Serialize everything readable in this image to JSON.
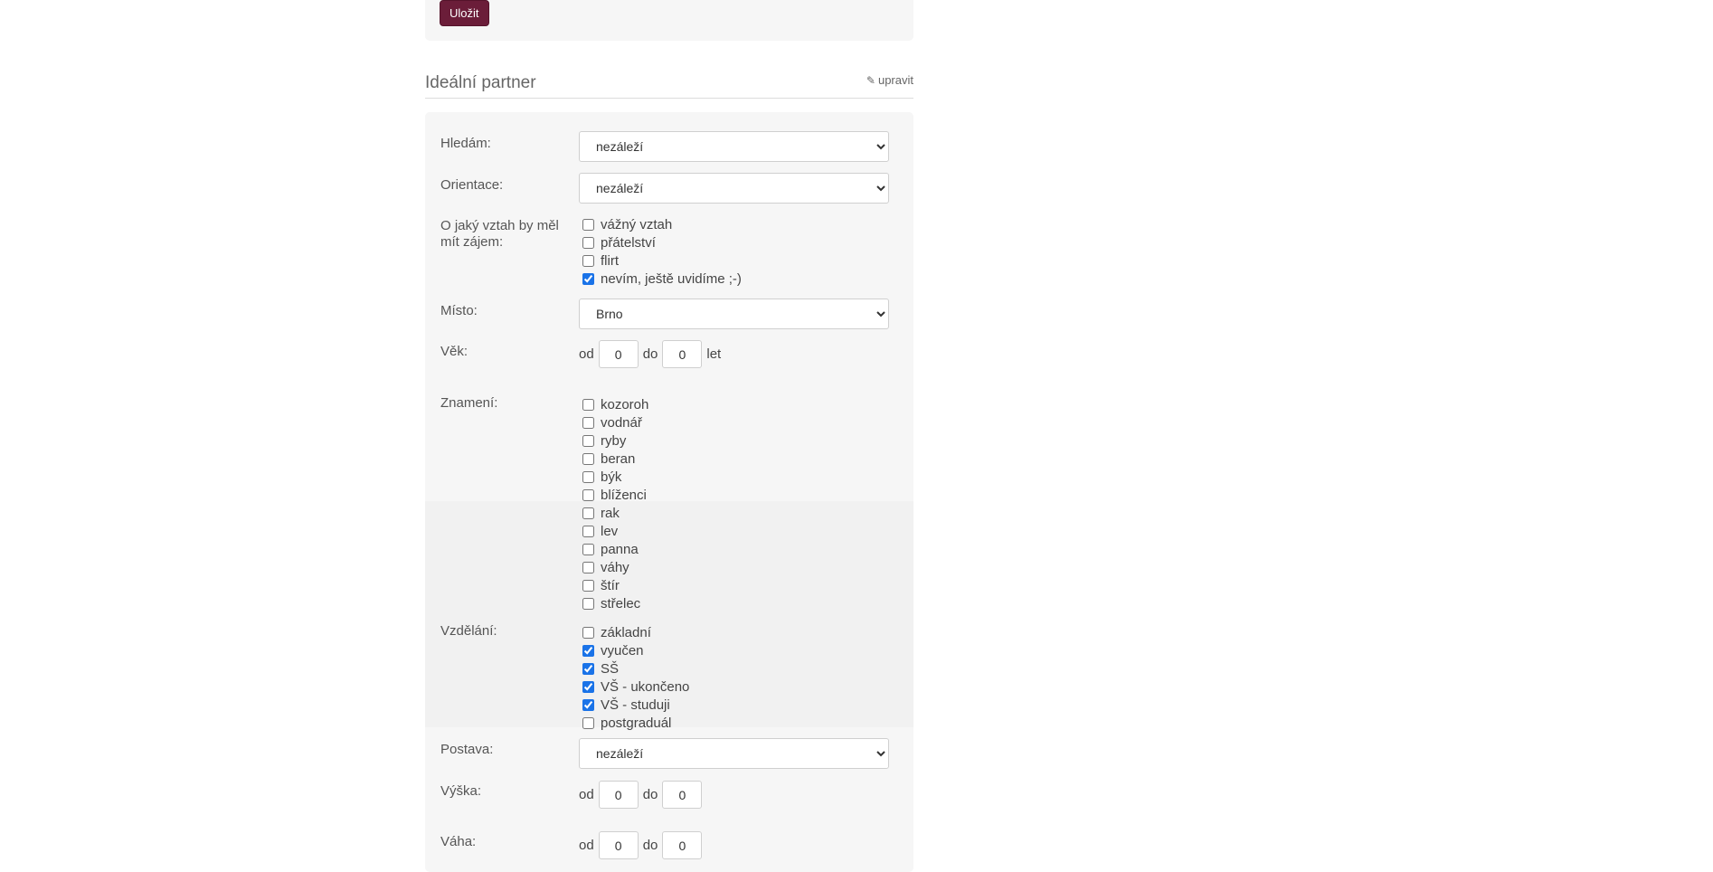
{
  "top": {
    "save_label": "Uložit"
  },
  "section": {
    "title": "Ideální partner",
    "edit_label": "upravit"
  },
  "form": {
    "seeking": {
      "label": "Hledám:",
      "value": "nezáleží"
    },
    "orientation": {
      "label": "Orientace:",
      "value": "nezáleží"
    },
    "relationship": {
      "label": "O jaký vztah by měl mít zájem:",
      "options": [
        {
          "label": "vážný vztah",
          "checked": false
        },
        {
          "label": "přátelství",
          "checked": false
        },
        {
          "label": "flirt",
          "checked": false
        },
        {
          "label": "nevím, ještě uvidíme ;-)",
          "checked": true
        }
      ]
    },
    "place": {
      "label": "Místo:",
      "value": "Brno"
    },
    "age": {
      "label": "Věk:",
      "from_label": "od",
      "from": "0",
      "to_label": "do",
      "to": "0",
      "unit": "let"
    },
    "sign": {
      "label": "Znamení:",
      "options": [
        {
          "label": "kozoroh",
          "checked": false
        },
        {
          "label": "vodnář",
          "checked": false
        },
        {
          "label": "ryby",
          "checked": false
        },
        {
          "label": "beran",
          "checked": false
        },
        {
          "label": "býk",
          "checked": false
        },
        {
          "label": "blíženci",
          "checked": false
        },
        {
          "label": "rak",
          "checked": false
        },
        {
          "label": "lev",
          "checked": false
        },
        {
          "label": "panna",
          "checked": false
        },
        {
          "label": "váhy",
          "checked": false
        },
        {
          "label": "štír",
          "checked": false
        },
        {
          "label": "střelec",
          "checked": false
        }
      ]
    },
    "education": {
      "label": "Vzdělání:",
      "options": [
        {
          "label": "základní",
          "checked": false
        },
        {
          "label": "vyučen",
          "checked": true
        },
        {
          "label": "SŠ",
          "checked": true
        },
        {
          "label": "VŠ - ukončeno",
          "checked": true
        },
        {
          "label": "VŠ - studuji",
          "checked": true
        },
        {
          "label": "postgraduál",
          "checked": false
        }
      ]
    },
    "build": {
      "label": "Postava:",
      "value": "nezáleží"
    },
    "height": {
      "label": "Výška:",
      "from_label": "od",
      "from": "0",
      "to_label": "do",
      "to": "0"
    },
    "weight": {
      "label": "Váha:",
      "from_label": "od",
      "from": "0",
      "to_label": "do",
      "to": "0"
    }
  }
}
